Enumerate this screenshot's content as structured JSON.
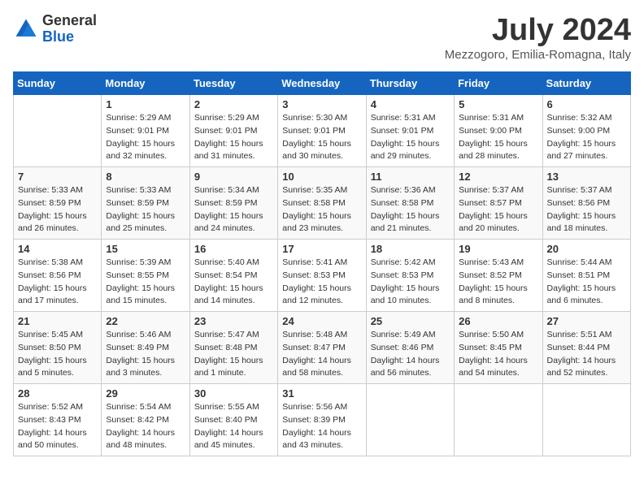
{
  "logo": {
    "general": "General",
    "blue": "Blue"
  },
  "title": "July 2024",
  "subtitle": "Mezzogoro, Emilia-Romagna, Italy",
  "days_of_week": [
    "Sunday",
    "Monday",
    "Tuesday",
    "Wednesday",
    "Thursday",
    "Friday",
    "Saturday"
  ],
  "weeks": [
    [
      {
        "day": "",
        "info": ""
      },
      {
        "day": "1",
        "info": "Sunrise: 5:29 AM\nSunset: 9:01 PM\nDaylight: 15 hours\nand 32 minutes."
      },
      {
        "day": "2",
        "info": "Sunrise: 5:29 AM\nSunset: 9:01 PM\nDaylight: 15 hours\nand 31 minutes."
      },
      {
        "day": "3",
        "info": "Sunrise: 5:30 AM\nSunset: 9:01 PM\nDaylight: 15 hours\nand 30 minutes."
      },
      {
        "day": "4",
        "info": "Sunrise: 5:31 AM\nSunset: 9:01 PM\nDaylight: 15 hours\nand 29 minutes."
      },
      {
        "day": "5",
        "info": "Sunrise: 5:31 AM\nSunset: 9:00 PM\nDaylight: 15 hours\nand 28 minutes."
      },
      {
        "day": "6",
        "info": "Sunrise: 5:32 AM\nSunset: 9:00 PM\nDaylight: 15 hours\nand 27 minutes."
      }
    ],
    [
      {
        "day": "7",
        "info": "Sunrise: 5:33 AM\nSunset: 8:59 PM\nDaylight: 15 hours\nand 26 minutes."
      },
      {
        "day": "8",
        "info": "Sunrise: 5:33 AM\nSunset: 8:59 PM\nDaylight: 15 hours\nand 25 minutes."
      },
      {
        "day": "9",
        "info": "Sunrise: 5:34 AM\nSunset: 8:59 PM\nDaylight: 15 hours\nand 24 minutes."
      },
      {
        "day": "10",
        "info": "Sunrise: 5:35 AM\nSunset: 8:58 PM\nDaylight: 15 hours\nand 23 minutes."
      },
      {
        "day": "11",
        "info": "Sunrise: 5:36 AM\nSunset: 8:58 PM\nDaylight: 15 hours\nand 21 minutes."
      },
      {
        "day": "12",
        "info": "Sunrise: 5:37 AM\nSunset: 8:57 PM\nDaylight: 15 hours\nand 20 minutes."
      },
      {
        "day": "13",
        "info": "Sunrise: 5:37 AM\nSunset: 8:56 PM\nDaylight: 15 hours\nand 18 minutes."
      }
    ],
    [
      {
        "day": "14",
        "info": "Sunrise: 5:38 AM\nSunset: 8:56 PM\nDaylight: 15 hours\nand 17 minutes."
      },
      {
        "day": "15",
        "info": "Sunrise: 5:39 AM\nSunset: 8:55 PM\nDaylight: 15 hours\nand 15 minutes."
      },
      {
        "day": "16",
        "info": "Sunrise: 5:40 AM\nSunset: 8:54 PM\nDaylight: 15 hours\nand 14 minutes."
      },
      {
        "day": "17",
        "info": "Sunrise: 5:41 AM\nSunset: 8:53 PM\nDaylight: 15 hours\nand 12 minutes."
      },
      {
        "day": "18",
        "info": "Sunrise: 5:42 AM\nSunset: 8:53 PM\nDaylight: 15 hours\nand 10 minutes."
      },
      {
        "day": "19",
        "info": "Sunrise: 5:43 AM\nSunset: 8:52 PM\nDaylight: 15 hours\nand 8 minutes."
      },
      {
        "day": "20",
        "info": "Sunrise: 5:44 AM\nSunset: 8:51 PM\nDaylight: 15 hours\nand 6 minutes."
      }
    ],
    [
      {
        "day": "21",
        "info": "Sunrise: 5:45 AM\nSunset: 8:50 PM\nDaylight: 15 hours\nand 5 minutes."
      },
      {
        "day": "22",
        "info": "Sunrise: 5:46 AM\nSunset: 8:49 PM\nDaylight: 15 hours\nand 3 minutes."
      },
      {
        "day": "23",
        "info": "Sunrise: 5:47 AM\nSunset: 8:48 PM\nDaylight: 15 hours\nand 1 minute."
      },
      {
        "day": "24",
        "info": "Sunrise: 5:48 AM\nSunset: 8:47 PM\nDaylight: 14 hours\nand 58 minutes."
      },
      {
        "day": "25",
        "info": "Sunrise: 5:49 AM\nSunset: 8:46 PM\nDaylight: 14 hours\nand 56 minutes."
      },
      {
        "day": "26",
        "info": "Sunrise: 5:50 AM\nSunset: 8:45 PM\nDaylight: 14 hours\nand 54 minutes."
      },
      {
        "day": "27",
        "info": "Sunrise: 5:51 AM\nSunset: 8:44 PM\nDaylight: 14 hours\nand 52 minutes."
      }
    ],
    [
      {
        "day": "28",
        "info": "Sunrise: 5:52 AM\nSunset: 8:43 PM\nDaylight: 14 hours\nand 50 minutes."
      },
      {
        "day": "29",
        "info": "Sunrise: 5:54 AM\nSunset: 8:42 PM\nDaylight: 14 hours\nand 48 minutes."
      },
      {
        "day": "30",
        "info": "Sunrise: 5:55 AM\nSunset: 8:40 PM\nDaylight: 14 hours\nand 45 minutes."
      },
      {
        "day": "31",
        "info": "Sunrise: 5:56 AM\nSunset: 8:39 PM\nDaylight: 14 hours\nand 43 minutes."
      },
      {
        "day": "",
        "info": ""
      },
      {
        "day": "",
        "info": ""
      },
      {
        "day": "",
        "info": ""
      }
    ]
  ]
}
